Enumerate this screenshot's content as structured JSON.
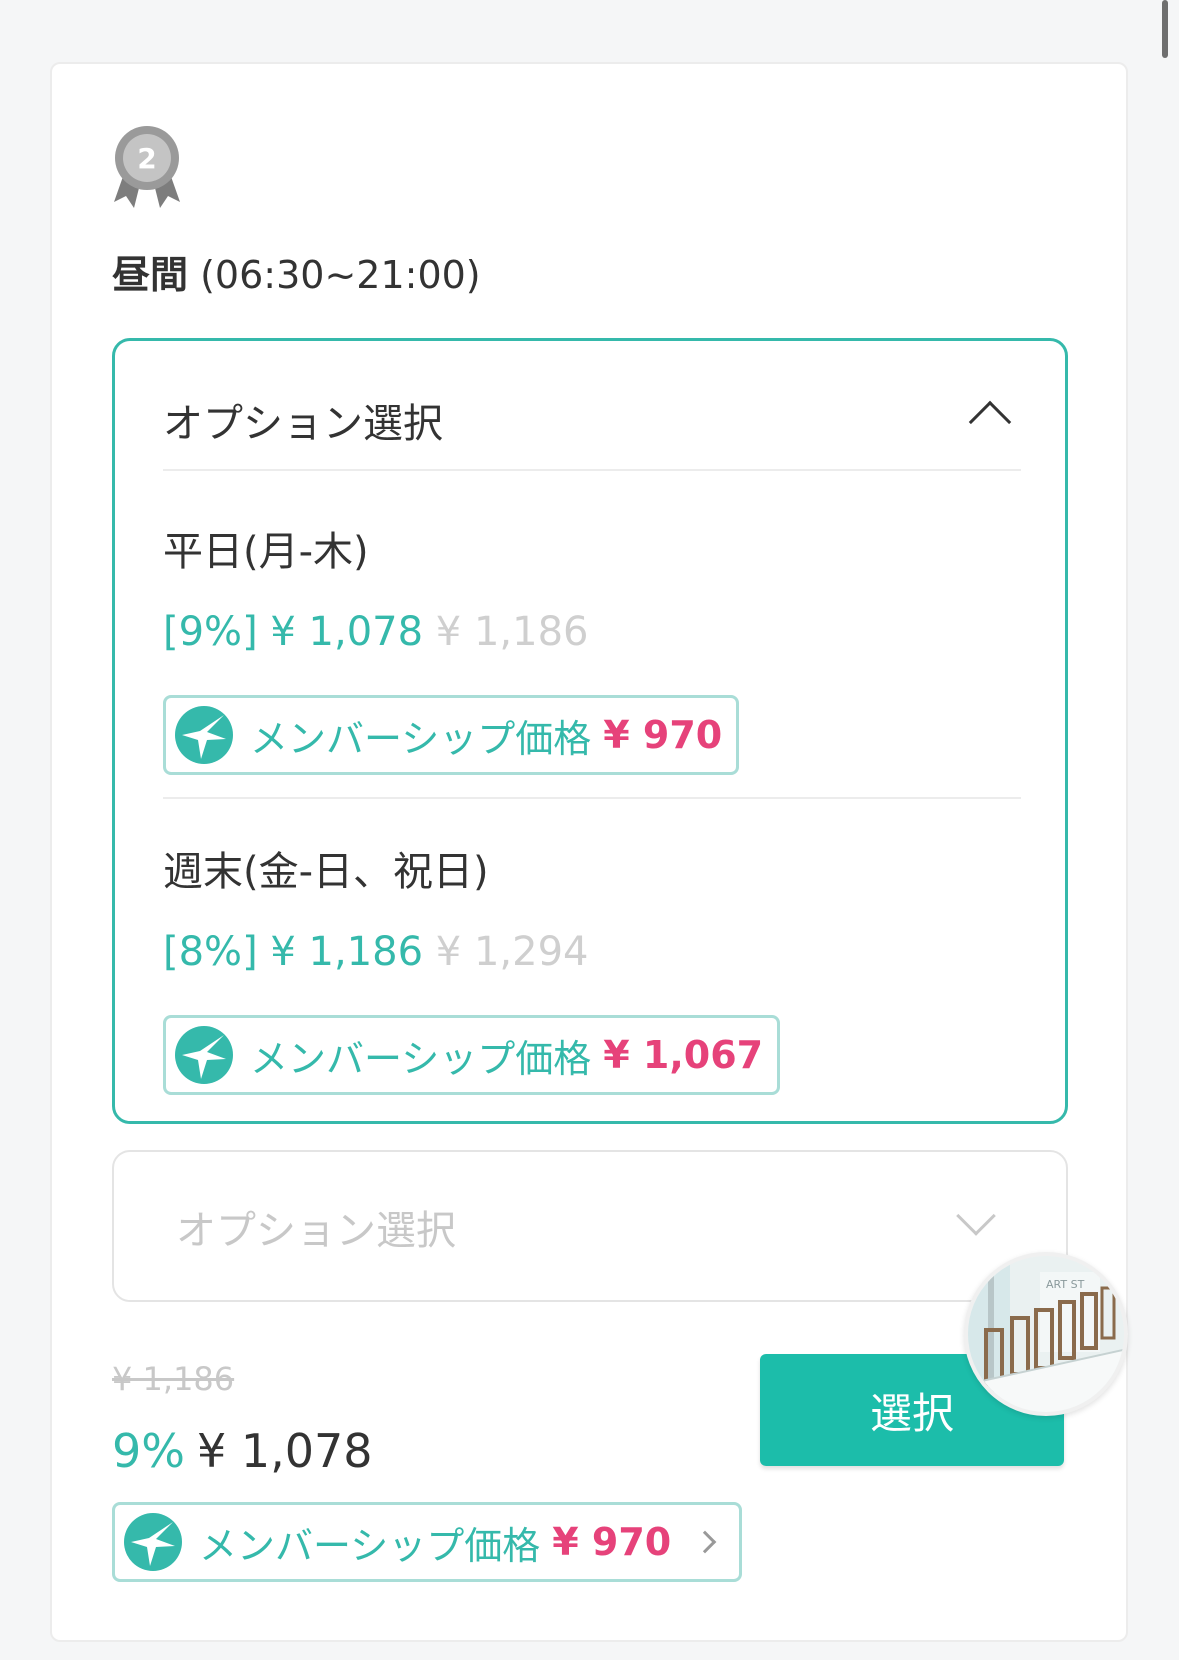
{
  "medal": {
    "rank": "2"
  },
  "period": {
    "name": "昼間",
    "hours": "(06:30~21:00)"
  },
  "option_panel": {
    "header": "オプション選択",
    "items": [
      {
        "name": "平日(月-木)",
        "discount": "[9%]",
        "price": "¥ 1,078",
        "original": "¥ 1,186",
        "member_label": "メンバーシップ価格",
        "member_price": "¥ 970"
      },
      {
        "name": "週末(金-日、祝日)",
        "discount": "[8%]",
        "price": "¥ 1,186",
        "original": "¥ 1,294",
        "member_label": "メンバーシップ価格",
        "member_price": "¥ 1,067"
      }
    ]
  },
  "option_closed": {
    "placeholder": "オプション選択"
  },
  "summary": {
    "original": "¥ 1,186",
    "discount": "9%",
    "price": "¥ 1,078",
    "member_label": "メンバーシップ価格",
    "member_price": "¥ 970"
  },
  "select_button": "選択",
  "thumbnail_sign": "ART ST",
  "colors": {
    "accent": "#35b9ab",
    "button": "#1cbdaa",
    "member_price": "#e6427a",
    "muted": "#c8c8c8"
  },
  "icons": {
    "medal": "medal-icon",
    "member": "membership-logo-icon",
    "expand": "chevron-up-icon",
    "collapse": "chevron-down-icon",
    "link": "chevron-right-icon"
  }
}
